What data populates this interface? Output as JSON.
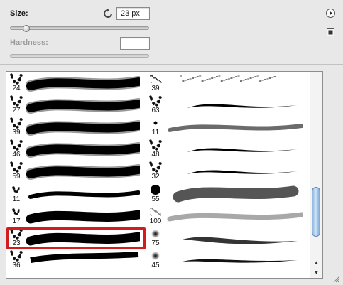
{
  "size": {
    "label": "Size:",
    "value": "23 px",
    "slider_fraction": 0.115
  },
  "hardness": {
    "label": "Hardness:",
    "value": "",
    "slider_fraction": null
  },
  "icons": {
    "reset": "reset-icon",
    "menu": "flyout-menu-icon",
    "new_preset": "new-preset-icon"
  },
  "brushes_left": [
    {
      "size": "24",
      "tip": "spatter",
      "stroke": "thick-soft"
    },
    {
      "size": "27",
      "tip": "spatter",
      "stroke": "thick-soft"
    },
    {
      "size": "39",
      "tip": "spatter",
      "stroke": "thick-soft"
    },
    {
      "size": "46",
      "tip": "spatter",
      "stroke": "thick-soft"
    },
    {
      "size": "59",
      "tip": "spatter",
      "stroke": "thick-soft"
    },
    {
      "size": "11",
      "tip": "spatter-small",
      "stroke": "medium"
    },
    {
      "size": "17",
      "tip": "spatter-small",
      "stroke": "thick"
    },
    {
      "size": "23",
      "tip": "spatter",
      "stroke": "thick",
      "selected": true
    },
    {
      "size": "36",
      "tip": "spatter",
      "stroke": "partial"
    }
  ],
  "brushes_right": [
    {
      "size": "39",
      "tip": "chalk",
      "stroke": "chalk"
    },
    {
      "size": "63",
      "tip": "spatter",
      "stroke": "taper"
    },
    {
      "size": "11",
      "tip": "dot-small",
      "stroke": "gray-rough"
    },
    {
      "size": "48",
      "tip": "spatter",
      "stroke": "taper"
    },
    {
      "size": "32",
      "tip": "spatter",
      "stroke": "taper"
    },
    {
      "size": "55",
      "tip": "hard-round",
      "stroke": "gray-wide"
    },
    {
      "size": "100",
      "tip": "dotted",
      "stroke": "gray-faint"
    },
    {
      "size": "75",
      "tip": "soft-round",
      "stroke": "soft-taper"
    },
    {
      "size": "45",
      "tip": "soft-round",
      "stroke": "rough-taper"
    }
  ],
  "scrollbar": {
    "up_label": "▲",
    "down_label": "▼",
    "thumb_fraction_top": 0.62,
    "thumb_fraction_size": 0.27
  }
}
